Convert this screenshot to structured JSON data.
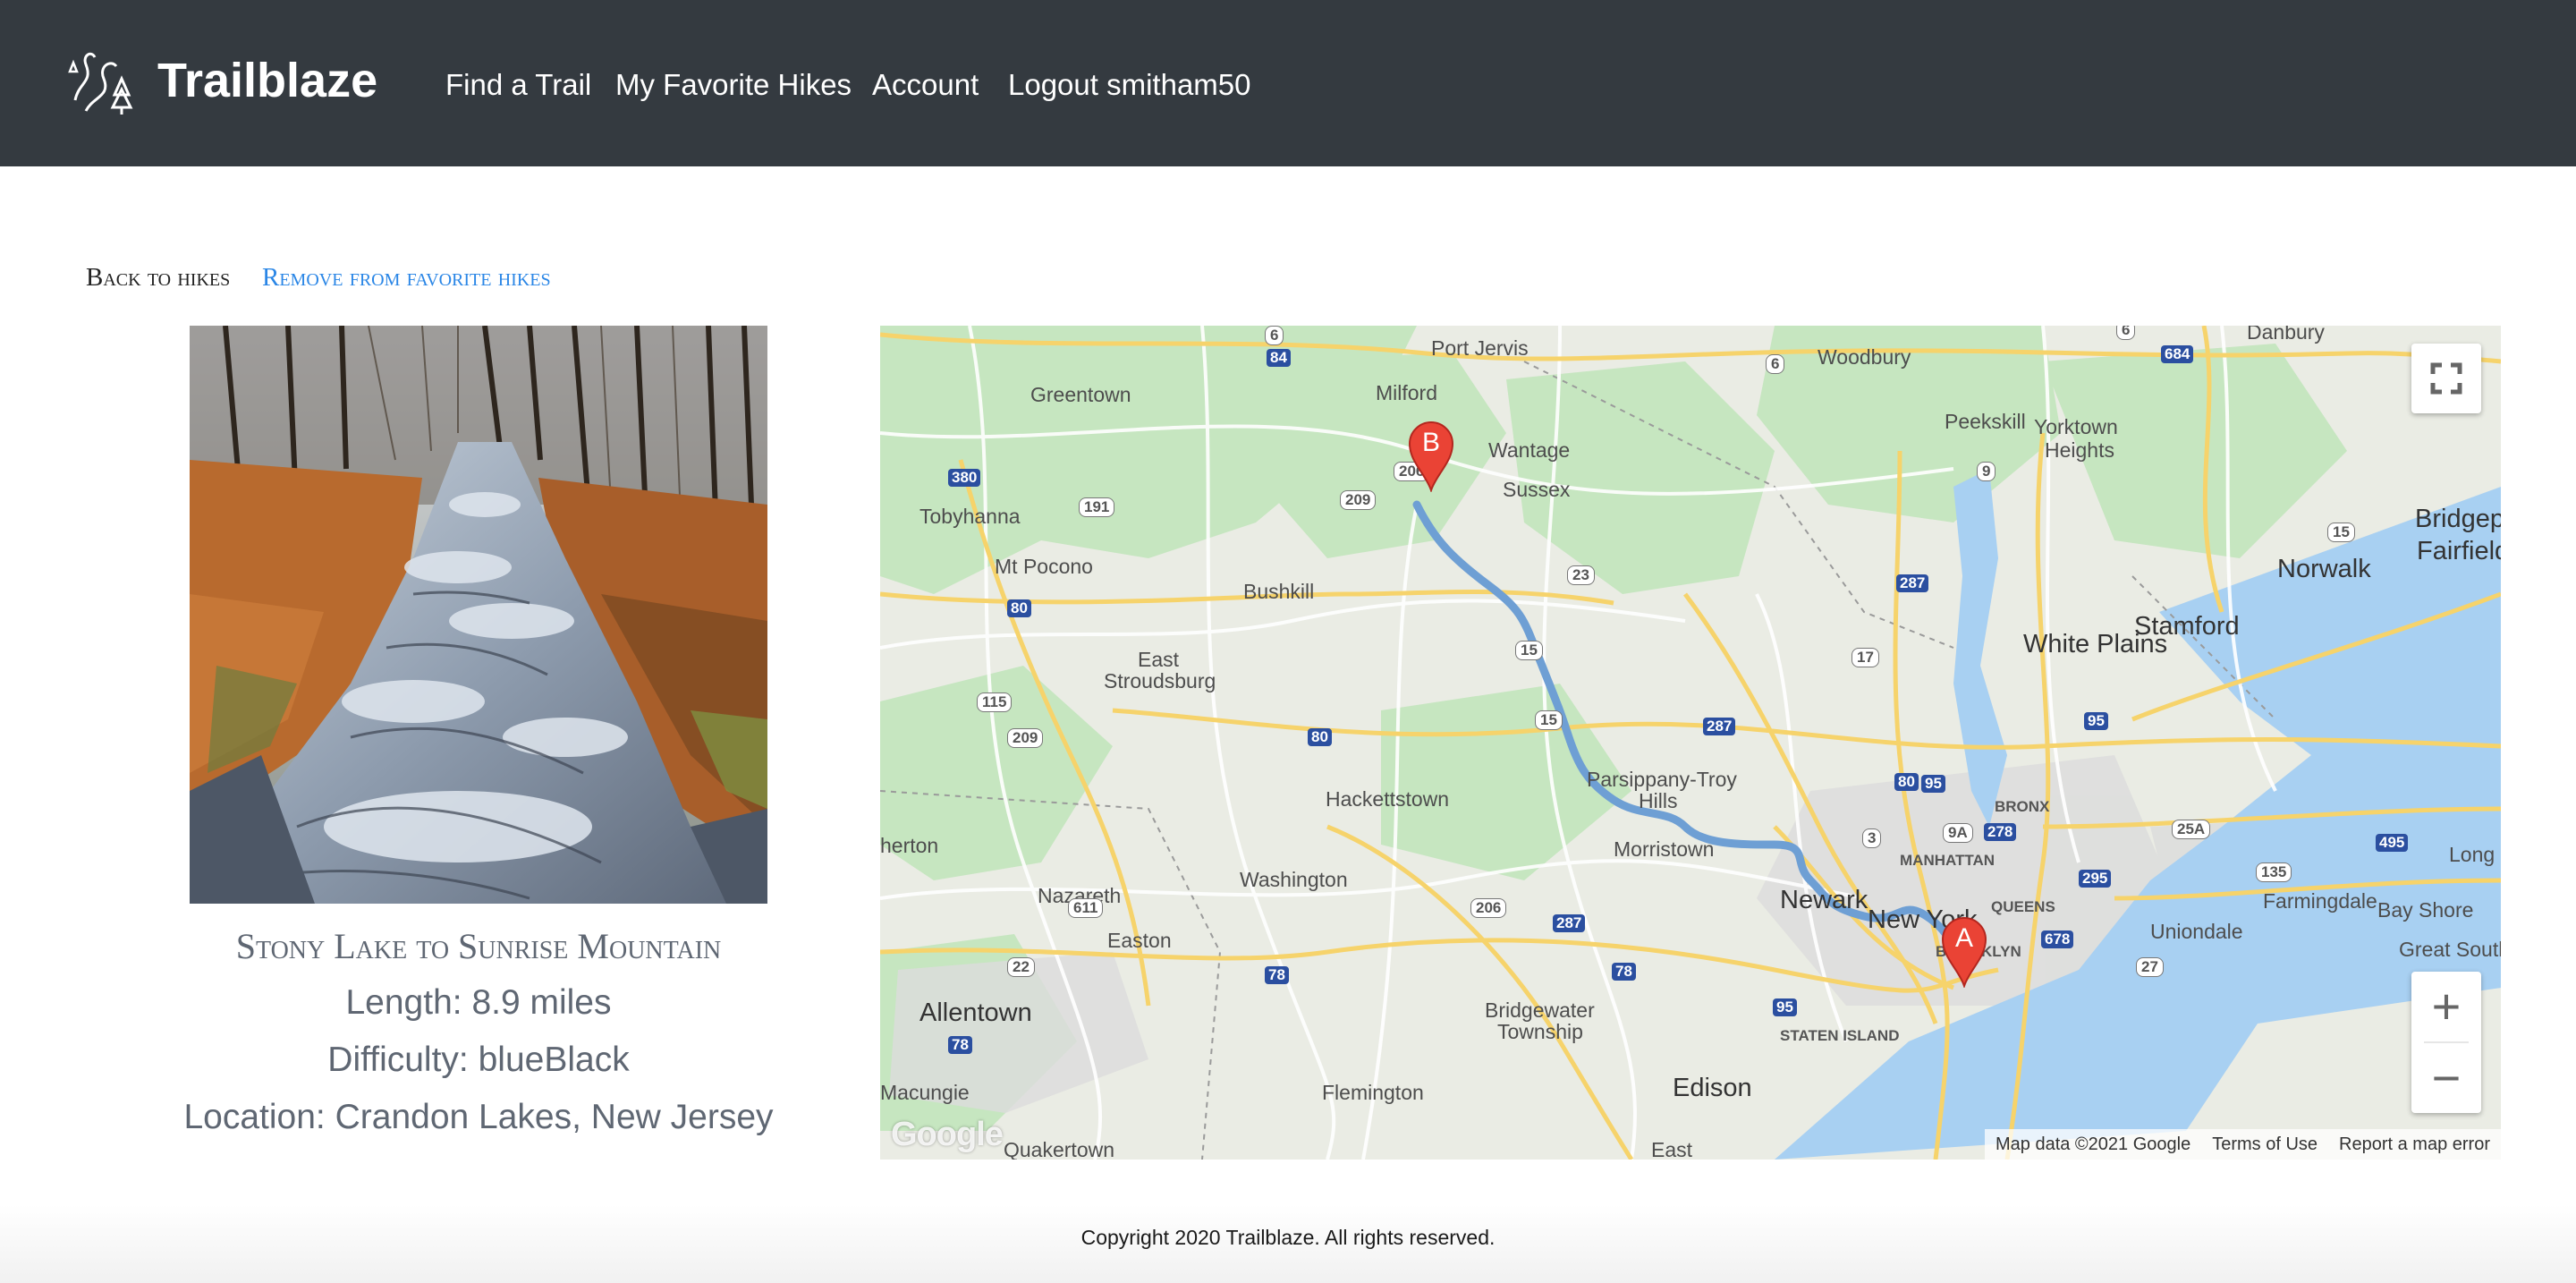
{
  "nav": {
    "brand": "Trailblaze",
    "links": [
      "Find a Trail",
      "My Favorite Hikes",
      "Account",
      "Logout smitham50"
    ]
  },
  "links": {
    "back": "Back to hikes",
    "remove": "Remove from favorite hikes"
  },
  "hike": {
    "name": "Stony Lake to Sunrise Mountain",
    "length": "Length: 8.9 miles",
    "difficulty": "Difficulty: blueBlack",
    "location": "Location: Crandon Lakes, New Jersey"
  },
  "map": {
    "marker_start": "A",
    "marker_end": "B",
    "labels": {
      "port_jervis": "Port Jervis",
      "woodbury": "Woodbury",
      "danbury": "Danbury",
      "greentown": "Greentown",
      "milford": "Milford",
      "wantage": "Wantage",
      "sussex": "Sussex",
      "peekskill": "Peekskill",
      "yorktown": "Yorktown",
      "heights": "Heights",
      "tobyhanna": "Tobyhanna",
      "bridgeport": "Bridgepo",
      "fairfield": "Fairfield",
      "mt_pocono": "Mt Pocono",
      "bushkill": "Bushkill",
      "norwalk": "Norwalk",
      "stamford": "Stamford",
      "white_plains": "White Plains",
      "east": "East",
      "stroudsburg": "Stroudsburg",
      "parsippany": "Parsippany-Troy",
      "hills": "Hills",
      "hackettstown": "Hackettstown",
      "bronx": "BRONX",
      "manhattan": "MANHATTAN",
      "morristown": "Morristown",
      "long_i": "Long I",
      "queens": "QUEENS",
      "nazareth": "Nazareth",
      "washington": "Washington",
      "newark": "Newark",
      "new_york": "New York",
      "farmingdale": "Farmingdale",
      "bay_shore": "Bay Shore",
      "easton": "Easton",
      "uniondale": "Uniondale",
      "great_south": "Great South",
      "allentown": "Allentown",
      "bridgewater": "Bridgewater",
      "township": "Township",
      "staten_island": "STATEN ISLAND",
      "brooklyn": "BROOKLYN",
      "macungie": "Macungie",
      "flemington": "Flemington",
      "edison": "Edison",
      "quakertown": "Quakertown",
      "east_bottom": "East",
      "herton": "herton"
    },
    "shields": {
      "s6a": "6",
      "s84": "84",
      "s6b": "6",
      "s684": "684",
      "s6c": "6",
      "s380": "380",
      "s191": "191",
      "s209a": "209",
      "s206a": "206",
      "s9": "9",
      "s23": "23",
      "s287a": "287",
      "s15a": "15",
      "s80a": "80",
      "s17": "17",
      "s15b": "15",
      "s15c": "15",
      "s115": "115",
      "s209b": "209",
      "s80b": "80",
      "s287b": "287",
      "s95a": "95",
      "s80c": "80",
      "s95b": "95",
      "s9a": "9A",
      "s278": "278",
      "s25a": "25A",
      "s495": "495",
      "s3": "3",
      "s295": "295",
      "s135": "135",
      "s611": "611",
      "s206b": "206",
      "s287c": "287",
      "s678": "678",
      "s27": "27",
      "s22": "22",
      "s78a": "78",
      "s78b": "78",
      "s95c": "95",
      "s78c": "78"
    },
    "google_logo": "Google",
    "attribution": [
      "Map data ©2021 Google",
      "Terms of Use",
      "Report a map error"
    ],
    "zoom_in": "+",
    "zoom_out": "−"
  },
  "footer": {
    "text": "Copyright 2020 Trailblaze. All rights reserved."
  },
  "colors": {
    "navbar": "#343a40",
    "link_blue": "#2a86e6",
    "info_gray": "#5f6773",
    "route": "#6e9fd4",
    "marker": "#ea4335",
    "water": "#a8d0f2",
    "park": "#c6e6c0",
    "highway": "#f6d36b"
  }
}
